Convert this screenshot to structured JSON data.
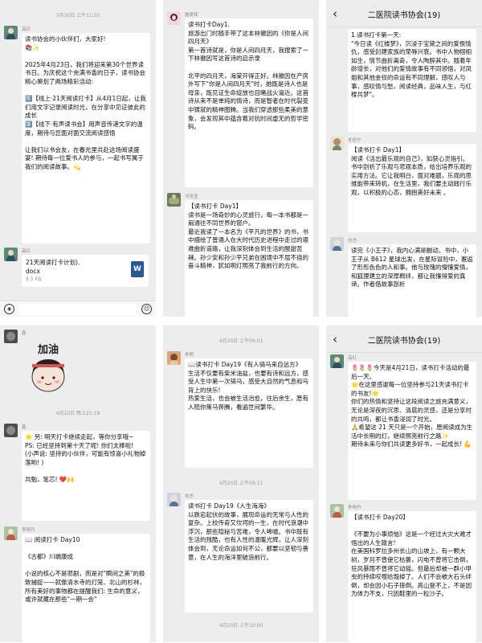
{
  "panels": [
    {
      "timestamp": "3月30日 上午11:03",
      "sender_top": "高红",
      "message_1": "读书协会的小伙伴们，大家好!\n📚✨\n\n2025年4月23日，我们将迎来第30个世界读书日。为庆祝这个充满书香的日子，读书协会精心策划了两场精彩活动:\n\n1️⃣【线上·21天阅读打卡】从4月1日起，让我们用文字记录阅读时光，在分享中见证彼此的成长\n2️⃣【线下·有声读书会】用声音传递文字的温度，期待与您面对面交流阅读感悟\n\n让我们以书会友，在春光里共赴这场阅读盛宴! 期待每一位爱书人的参与，一起书写属于我们的阅读故事。💫",
      "sender_file": "高红",
      "file_name": "21天阅读打卡计划).\ndocx",
      "file_size": "8.5 KB",
      "file_badge": "W"
    },
    {
      "sender_1": "施爱辉",
      "message_1": "读书打卡Day1.\n旅游出门时随手带了这本林徽因的《你是人间四月天》\n第一首诗就是，你是人间四月天，我搜索了一下林徽因写这首诗的启示录\n\n北平的四月天，海棠开得正好。林徽因在产房外写下\"你是人间四月天\"时，她既是诗人也是母亲，既见证生命绽放也目睹战火逼近。这首诗从来不是单纯的情诗，而是智者在时代裂变中铸就的精神图腾。当我们穿透那些柔美的意象，会发现其中蕴含着对抗时间虚无的哲学密码。",
      "sender_2": "冯宝宝",
      "message_2": "【读书打卡 Day1】\n读书是一场奇妙的心灵旅行，每一本书都是一扇通往不同世界的窗户。\n最近我读了一本名为《平凡的世界》的书，书中描绘了普通人在大时代历史进程中走过的艰难曲折道路，让我深刻体会到生活的酸甜苦辣。孙少安和孙少平兄弟在困境中不屈不挠的奋斗精神，犹如明灯照亮了我前行的方向。"
    },
    {
      "group_title": "二医院读书协会(19)",
      "message_1": "1.读书打卡第一天:\n\"今日读《红楼梦》，沉浸于宝黛之间的爱恨情仇，感受封建家族的荣辱兴衰。书中人物栩栩如生，情节曲折离奇，令人陶醉其中。随着年龄增长，对他们的爱情故事有不同领悟，对凤姐和其他金钗的命运有不同理解，感叹人与事，感叹情与愁，阅读经典，品味人生，与红楼共梦\"。",
      "sender_2": "冬佳宁",
      "message_2": "【读书打卡 Day1】\n阅读《活出最乐观的自己》，如获心灵指引。书中剖析了乐观与悲观本质，给出培养乐观的实用方法。它让我明白，面对难题，乐观的思维能带来转机，在生活里，我们要主动践行乐观，以积极的心态，拥抱美好未来 。",
      "sender_3": "刘杰",
      "message_3": "读完《小王子》，我内心满是触动。书中，小王子从 B612 星球出发，在星际冒险中，邂逅了形形色色的人和事。他与玫瑰的懵懂爱情，和狐狸建立的深厚羁绊，都让我懂得爱的真谛。作者借故事剖析"
    },
    {
      "sender_top": "鑫",
      "timestamp": "4月10日 晚上21:18",
      "sender_2": "鑫",
      "message_2": "🌟 另: 明天打卡继续走起，等你分享哦~\nPS: 已经坚持到第十天了呢! 你们太棒啦!\n(小声说: 坚持的小伙伴，可能有惊喜小礼物掉落哟! )\n\n共勉，笔芯! ❤️🙌",
      "sender_3": "李明丹",
      "message_3": "📖 阅读打卡 Day10\n\n《古都》川端康成\n\n小说的核心不是悲剧，而是对\"瞬间之美\"的极致捕捉——就像清水寺的灯笼、北山的杉林，所有美好的事物都在提醒我们: 生命的意义，或许就藏在那些\"一期一会\"",
      "sticker_text": "加油"
    },
    {
      "timestamp_1": "4月20日 上午09:01",
      "sender_1": "李明",
      "message_1": "📖读书打卡 Day19《有人骑马来自远方》\n生活不仅要有柴米油盐，也要有诗和远方，感受人生中第一次骑马，感受大自然的气息和马背上的快乐!\n热爱生活，也会被生活治愈，往后余生，愿有人陪你策马奔腾，看遍世间繁华。",
      "timestamp_2": "4月20日 上午09:11",
      "sender_2": "刘杰",
      "message_2": "读书打卡 Day19《人生海海》\n以跌宕起伏的故事，展现命运的无常与人性的复杂。上校传奇又坎坷的一生，在时代浪潮中浮沉，那些隐秘与苦难，令人唏嘘。书中既有生活的残酷，也有人性的温暖光辉，让人深刻体会到，无论命运如何不公，都要以坚韧与善意，在人生的海洋里破浪前行。",
      "timestamp_3": "4月20日 上午10:00"
    },
    {
      "group_title": "二医院读书协会(19)",
      "sender_1": "高红",
      "message_1": "🌷🌷🌷今天是4月21日，读书打卡活动的最后一天。\n🌟在这里感谢每一位坚持参与21天读书打卡的书友!🌟\n你们的热情和坚持让这段阅读之旅充满意义，无论是深夜的沉思、清晨的灵感，还是分享时的共鸣，都让书香浸润了时光。\n🙏希望这 21 天只是一个开始，愿阅读成为生活中长明的灯，继续照亮前行之路✨\n期待未来与你们共读更多好书，一起成长! 💪",
      "sender_2": "李明丹",
      "message_2": "【读书打卡 Day20】\n\n《不要为小事烦恼》这是一个经过大灾大难才悟出的人生箴言!\n在美国科罗拉多州长山的山坡上，有一颗大树，岁月不曾使它枯萎，闪电不曾将它击倒，狂风暴雨不曾将它动摇。但最后却被一群小甲虫的持续咬噬给毁掉了。人们不会被大石头绊倒，却会因小石子摔倒。高山登不上，不是因为体力不支，只因鞋里的一粒沙子。"
    }
  ],
  "icons": {
    "back": "chevron-left-icon",
    "voice": "voice-icon",
    "emoji": "emoji-icon"
  }
}
